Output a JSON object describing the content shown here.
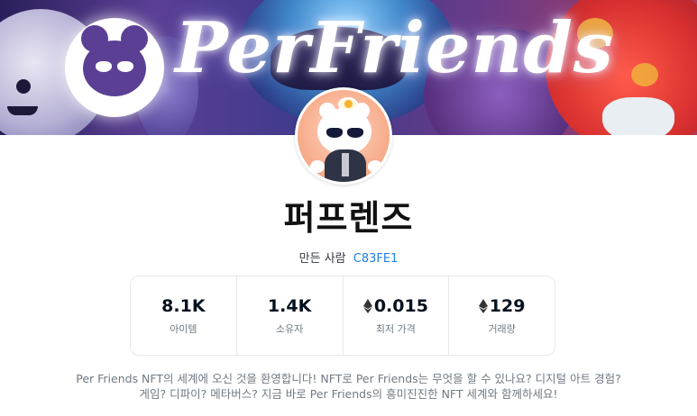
{
  "banner": {
    "logo_text": "PerFriends"
  },
  "collection": {
    "title": "퍼프렌즈",
    "creator_prefix": "만든 사람",
    "creator_name": "C83FE1"
  },
  "stats": [
    {
      "value": "8.1K",
      "label": "아이템",
      "eth": false
    },
    {
      "value": "1.4K",
      "label": "소유자",
      "eth": false
    },
    {
      "value": "0.015",
      "label": "최저 가격",
      "eth": true
    },
    {
      "value": "129",
      "label": "거래량",
      "eth": true
    }
  ],
  "description": {
    "line1": "Per Friends NFT의 세계에 오신 것을 환영합니다! NFT로 Per Friends는 무엇을 할 수 있나요? 디지털 아트 경험?",
    "line2": "게임? 디파이? 메타버스? 지금 바로 Per Friends의 흥미진진한 NFT 세계와 함께하세요!"
  },
  "colors": {
    "link": "#2081e2",
    "muted": "#707a83",
    "border": "#e5e8eb"
  }
}
